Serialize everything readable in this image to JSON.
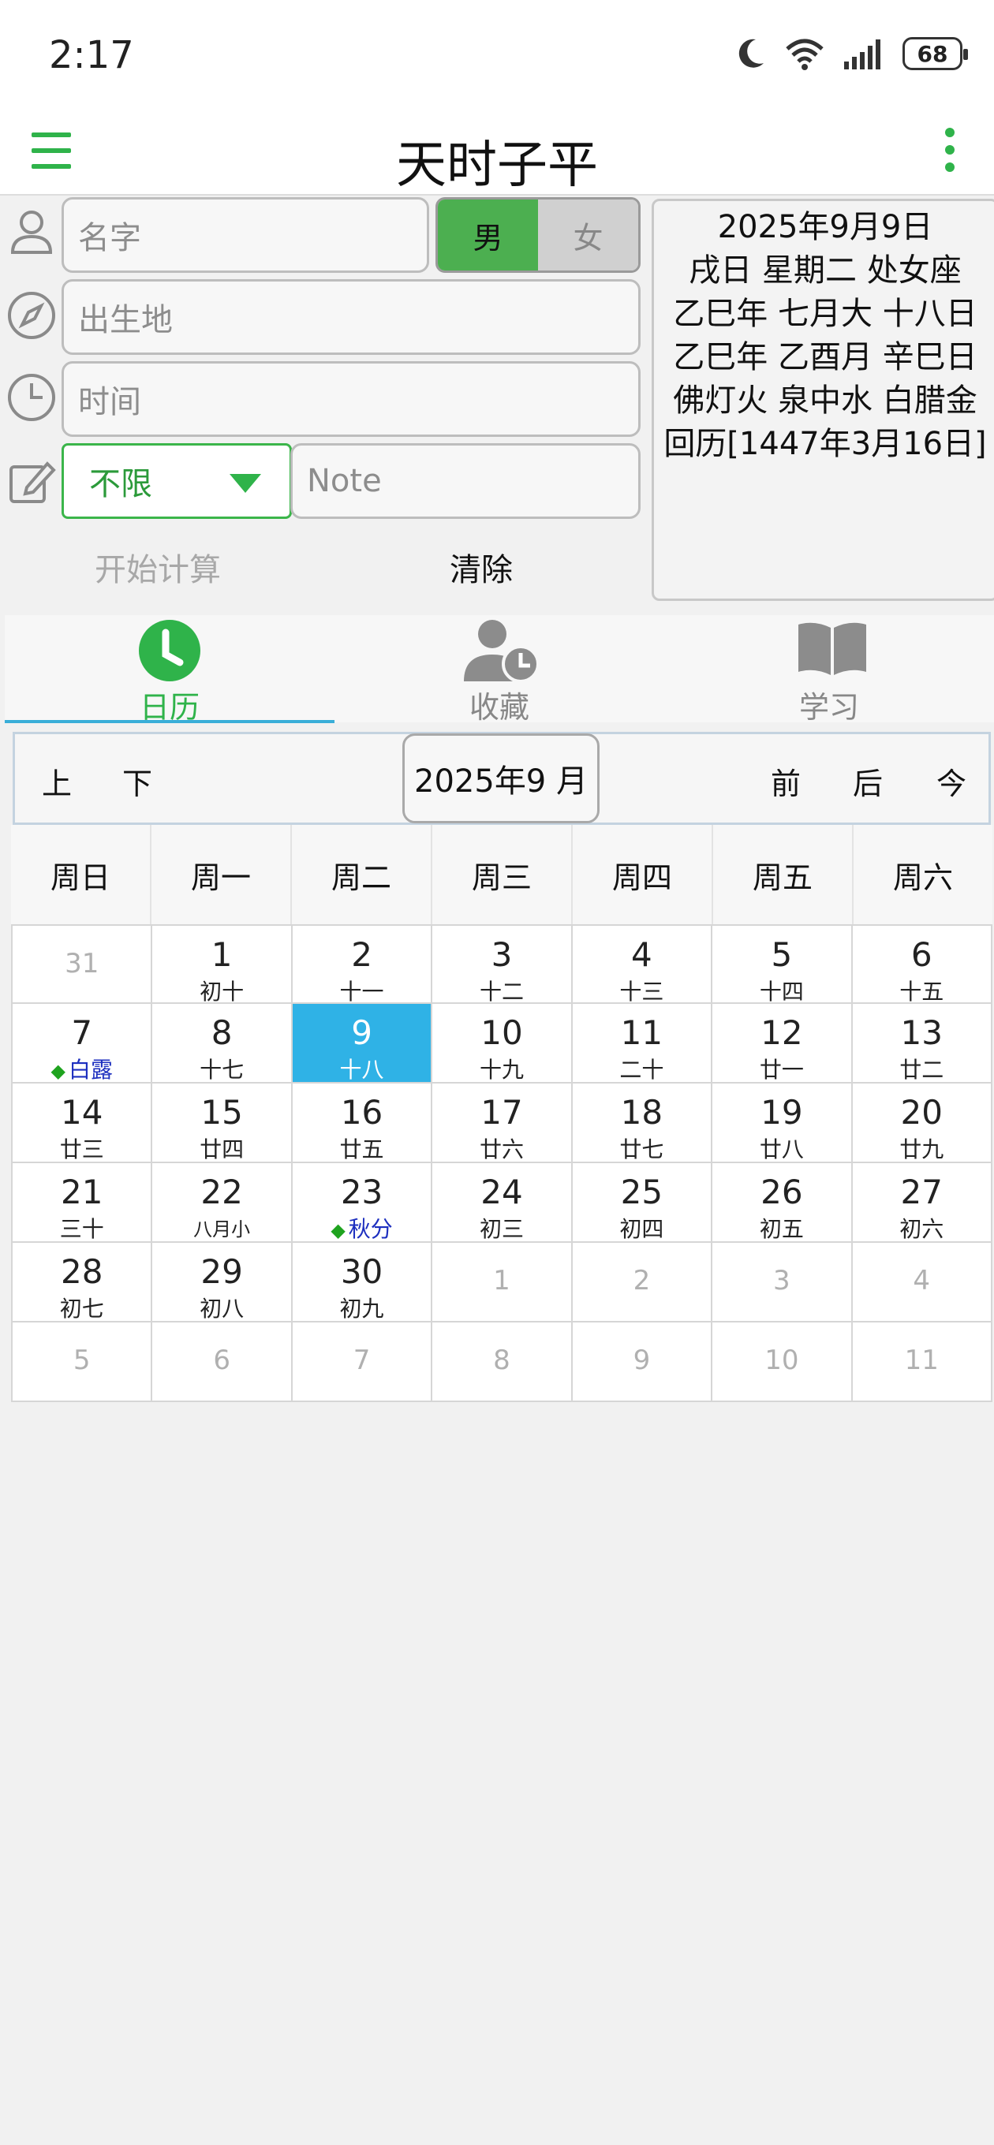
{
  "status_bar": {
    "time": "2:17",
    "battery": "68"
  },
  "app": {
    "title": "天时子平"
  },
  "form": {
    "name_placeholder": "名字",
    "gender_male": "男",
    "gender_female": "女",
    "birthplace_placeholder": "出生地",
    "time_placeholder": "时间",
    "select_value": "不限",
    "note_placeholder": "Note",
    "start_button": "开始计算",
    "clear_button": "清除"
  },
  "info_panel": {
    "lines": [
      "2025年9月9日",
      "戌日 星期二 处女座",
      "乙巳年 七月大 十八日",
      "乙巳年 乙酉月 辛巳日",
      "佛灯火 泉中水 白腊金",
      "回历[1447年3月16日]"
    ]
  },
  "tabs": [
    {
      "label": "日历",
      "active": true
    },
    {
      "label": "收藏",
      "active": false
    },
    {
      "label": "学习",
      "active": false
    }
  ],
  "calendar_nav": {
    "prev": "上",
    "next": "下",
    "month_label": "2025年9 月",
    "back": "前",
    "forward": "后",
    "today": "今"
  },
  "weekdays": [
    "周日",
    "周一",
    "周二",
    "周三",
    "周四",
    "周五",
    "周六"
  ],
  "weeks": [
    [
      {
        "day": "31",
        "lunar": "",
        "other": true
      },
      {
        "day": "1",
        "lunar": "初十"
      },
      {
        "day": "2",
        "lunar": "十一"
      },
      {
        "day": "3",
        "lunar": "十二"
      },
      {
        "day": "4",
        "lunar": "十三"
      },
      {
        "day": "5",
        "lunar": "十四"
      },
      {
        "day": "6",
        "lunar": "十五"
      }
    ],
    [
      {
        "day": "7",
        "lunar": "白露",
        "term": true
      },
      {
        "day": "8",
        "lunar": "十七"
      },
      {
        "day": "9",
        "lunar": "十八",
        "today": true
      },
      {
        "day": "10",
        "lunar": "十九"
      },
      {
        "day": "11",
        "lunar": "二十"
      },
      {
        "day": "12",
        "lunar": "廿一"
      },
      {
        "day": "13",
        "lunar": "廿二"
      }
    ],
    [
      {
        "day": "14",
        "lunar": "廿三"
      },
      {
        "day": "15",
        "lunar": "廿四"
      },
      {
        "day": "16",
        "lunar": "廿五"
      },
      {
        "day": "17",
        "lunar": "廿六"
      },
      {
        "day": "18",
        "lunar": "廿七"
      },
      {
        "day": "19",
        "lunar": "廿八"
      },
      {
        "day": "20",
        "lunar": "廿九"
      }
    ],
    [
      {
        "day": "21",
        "lunar": "三十"
      },
      {
        "day": "22",
        "lunar": "八月小",
        "small": true
      },
      {
        "day": "23",
        "lunar": "秋分",
        "term": true
      },
      {
        "day": "24",
        "lunar": "初三"
      },
      {
        "day": "25",
        "lunar": "初四"
      },
      {
        "day": "26",
        "lunar": "初五"
      },
      {
        "day": "27",
        "lunar": "初六"
      }
    ],
    [
      {
        "day": "28",
        "lunar": "初七"
      },
      {
        "day": "29",
        "lunar": "初八"
      },
      {
        "day": "30",
        "lunar": "初九"
      },
      {
        "day": "1",
        "lunar": "",
        "other": true
      },
      {
        "day": "2",
        "lunar": "",
        "other": true
      },
      {
        "day": "3",
        "lunar": "",
        "other": true
      },
      {
        "day": "4",
        "lunar": "",
        "other": true
      }
    ],
    [
      {
        "day": "5",
        "lunar": "",
        "other": true
      },
      {
        "day": "6",
        "lunar": "",
        "other": true
      },
      {
        "day": "7",
        "lunar": "",
        "other": true
      },
      {
        "day": "8",
        "lunar": "",
        "other": true
      },
      {
        "day": "9",
        "lunar": "",
        "other": true
      },
      {
        "day": "10",
        "lunar": "",
        "other": true
      },
      {
        "day": "11",
        "lunar": "",
        "other": true
      }
    ]
  ],
  "colors": {
    "accent_green": "#2fb34a",
    "today_blue": "#2fb2e6",
    "solar_term_text": "#1d2fbf"
  }
}
